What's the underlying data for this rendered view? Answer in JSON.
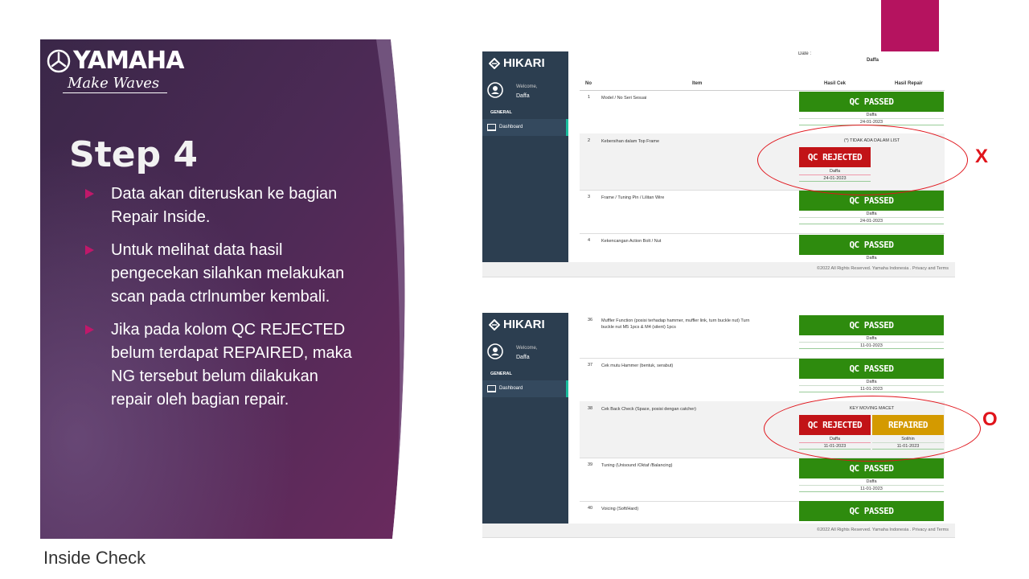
{
  "slide": {
    "logo_text": "YAMAHA",
    "tagline": "Make Waves",
    "title": "Step 4",
    "bullets": [
      "Data akan diteruskan ke bagian Repair Inside.",
      "Untuk melihat data hasil pengecekan silahkan melakukan scan pada ctrlnumber kembali.",
      "Jika pada kolom QC REJECTED belum terdapat REPAIRED, maka NG tersebut belum dilakukan repair oleh bagian repair."
    ],
    "footer_label": "Inside Check",
    "mark_x": "X",
    "mark_o": "O",
    "colors": {
      "panel": "#4b2a52",
      "accent": "#c0186a",
      "magenta_block": "#b5135f",
      "annotation": "#e0141b"
    }
  },
  "app": {
    "brand": "HIKARI",
    "welcome": "Welcome,",
    "username": "Daffa",
    "section": "GENERAL",
    "nav_dashboard": "Dashboard",
    "footer": "©2022 All Rights Reserved. Yamaha Indonesia . Privacy and Terms",
    "badge_passed": "QC PASSED",
    "badge_rejected": "QC REJECTED",
    "badge_repaired": "REPAIRED",
    "colors": {
      "sidebar": "#2c3e50",
      "passed": "#2e8b0e",
      "rejected": "#c21317",
      "repaired": "#d49a00"
    }
  },
  "shot1": {
    "date_label": "Date :",
    "date_value": "Daffa",
    "headers": {
      "no": "No",
      "item": "Item",
      "hasil_cek": "Hasil Cek",
      "hasil_repair": "Hasil Repair"
    },
    "rows": [
      {
        "no": "1",
        "item": "Model / No Seri Sesuai",
        "name": "Daffa",
        "date": "24-01-2023"
      },
      {
        "no": "2",
        "item": "Kebersihan dalam Top Frame",
        "notice": "(*) TIDAK ADA DALAM LIST",
        "name": "Daffa",
        "date": "24-01-2023"
      },
      {
        "no": "3",
        "item": "Frame / Tuning Pin / Lilitan Wire",
        "name": "Daffa",
        "date": "24-01-2023"
      },
      {
        "no": "4",
        "item": "Kekencangan Action Bolt / Nut",
        "name": "Daffa"
      }
    ]
  },
  "shot2": {
    "rows": [
      {
        "no": "36",
        "item": "Muffler Function (posisi terhadap hammer, muffler link, turn buckle nut) Turn buckle nut M5 1pcs & M4 (silent) 1pcs",
        "name": "Daffa",
        "date": "11-01-2023"
      },
      {
        "no": "37",
        "item": "Cek mutu Hammer (bentuk, serabut)",
        "name": "Daffa",
        "date": "11-01-2023"
      },
      {
        "no": "38",
        "item": "Cek Back Check (Space, posisi dengan catcher)",
        "notice": "KEY MOVING MACET",
        "name": "Daffa",
        "date": "11-01-2023",
        "repair_name": "Solihin",
        "repair_date": "11-01-2023"
      },
      {
        "no": "39",
        "item": "Tuning (Unisound /Oktaf /Balancing)",
        "name": "Daffa",
        "date": "11-01-2023"
      },
      {
        "no": "40",
        "item": "Voicing (Soft/Hard)"
      }
    ]
  }
}
